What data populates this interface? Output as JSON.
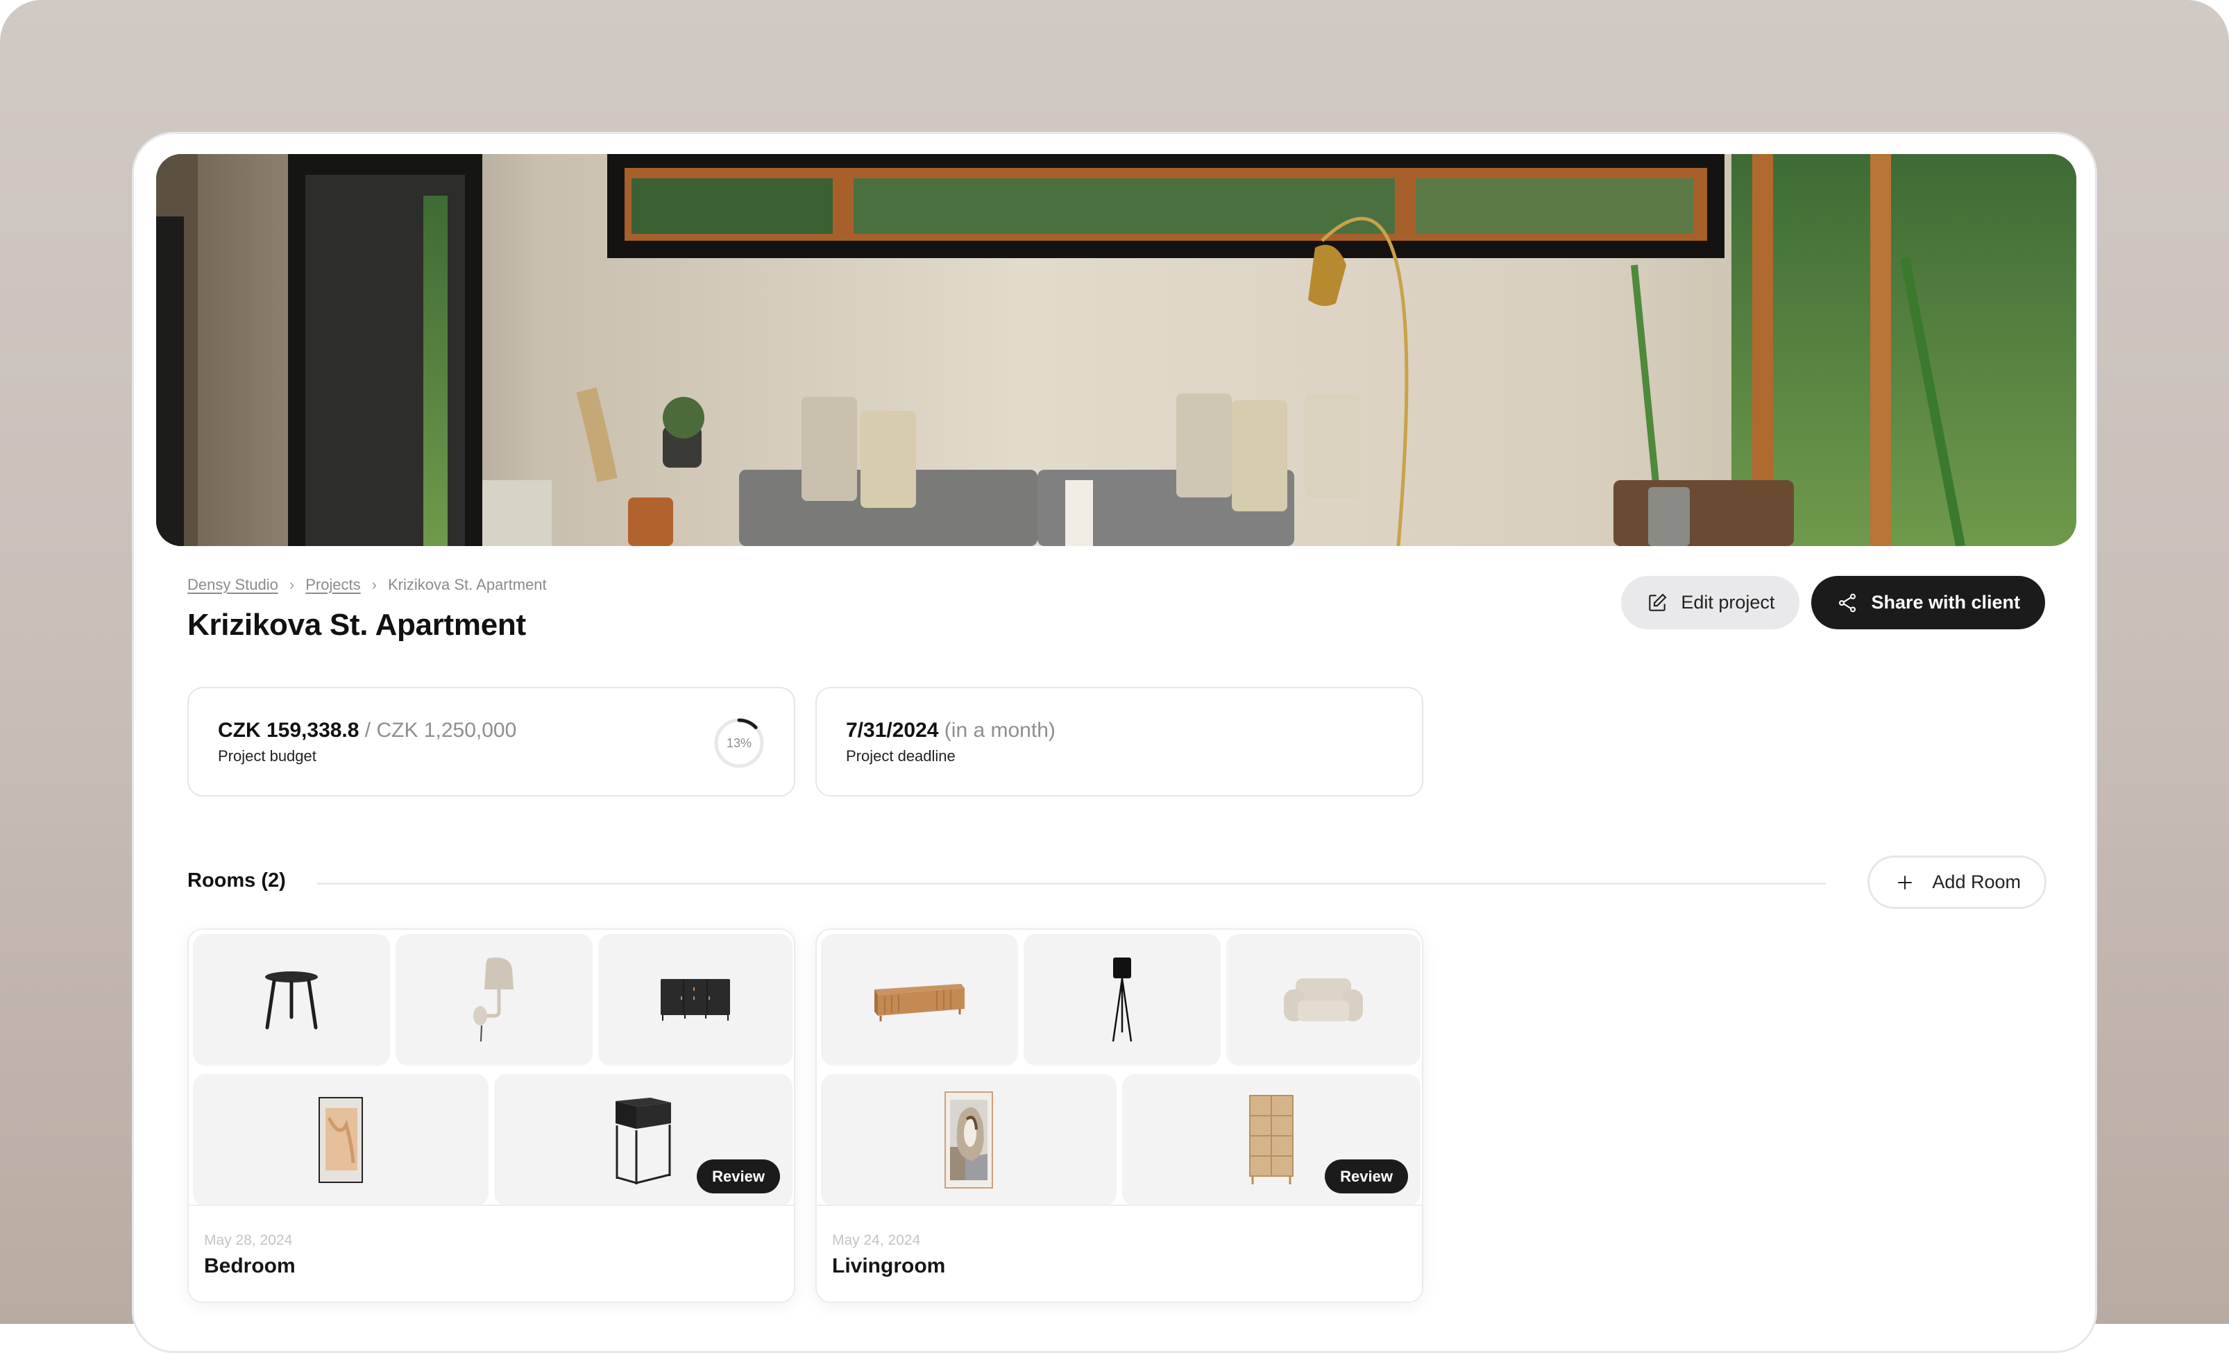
{
  "breadcrumb": {
    "items": [
      {
        "label": "Densy Studio",
        "link": true
      },
      {
        "label": "Projects",
        "link": true
      },
      {
        "label": "Krizikova St. Apartment",
        "link": false
      }
    ],
    "separator": "›"
  },
  "header": {
    "title": "Krizikova St. Apartment",
    "edit_label": "Edit project",
    "share_label": "Share with client"
  },
  "budget": {
    "spent": "CZK 159,338.8",
    "separator": " / ",
    "total": "CZK 1,250,000",
    "label": "Project budget",
    "percent_text": "13%",
    "progress": 0.13
  },
  "deadline": {
    "date": "7/31/2024",
    "relative": " (in a month)",
    "label": "Project deadline"
  },
  "rooms": {
    "title": "Rooms (2)",
    "add_label": "Add Room",
    "review_label": "Review",
    "items": [
      {
        "date": "May 28, 2024",
        "name": "Bedroom",
        "products": [
          "side-table",
          "wall-lamp",
          "sideboard",
          "art-print",
          "nightstand"
        ],
        "review": true
      },
      {
        "date": "May 24, 2024",
        "name": "Livingroom",
        "products": [
          "tv-stand",
          "tripod-floor-lamp",
          "armchair",
          "abstract-art-print",
          "display-cabinet"
        ],
        "review": true
      }
    ]
  },
  "colors": {
    "accent": "#1b1b1b",
    "backdrop_top": "#d1c9c4",
    "backdrop_bottom": "#b8aba2",
    "tile_bg": "#f3f3f3",
    "ring_track": "#e8e8ea"
  }
}
